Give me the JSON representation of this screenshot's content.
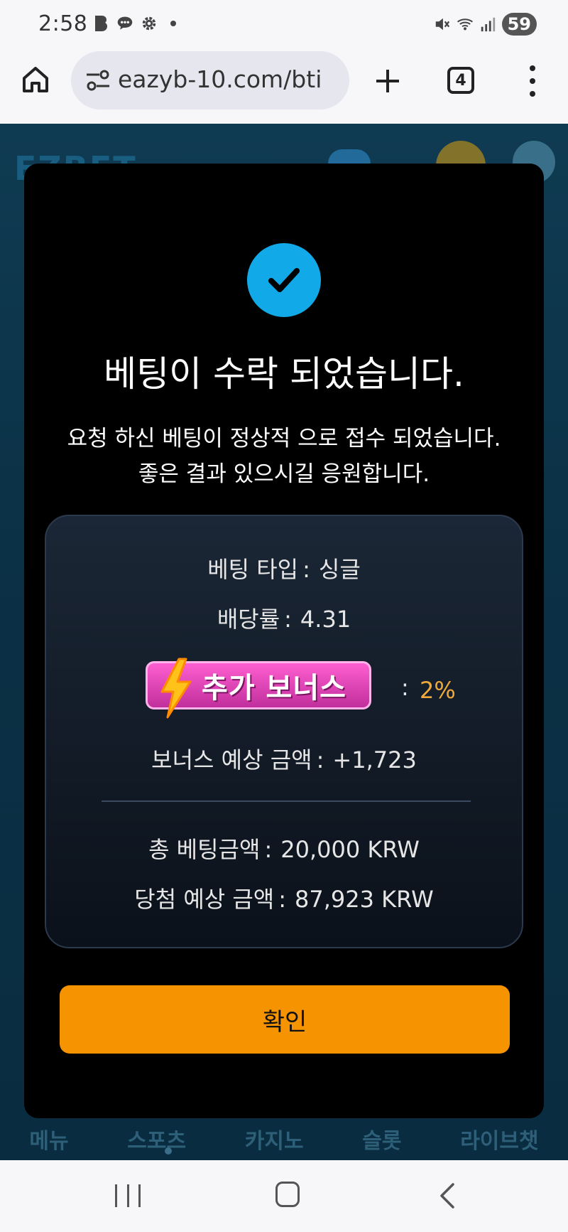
{
  "status_bar": {
    "time": "2:58",
    "battery": "59",
    "icons_left": [
      "b-app-icon",
      "chat-icon",
      "gear-icon",
      "dot-icon"
    ],
    "icons_right": [
      "mute-icon",
      "wifi-icon",
      "signal-icon"
    ]
  },
  "browser": {
    "url": "eazyb-10.com/bti",
    "tab_count": "4"
  },
  "background_site": {
    "logo": "EZBET",
    "bottom_nav": [
      "메뉴",
      "스포츠",
      "카지노",
      "슬롯",
      "라이브챗"
    ]
  },
  "modal": {
    "title": "베팅이 수락 되었습니다.",
    "description": "요청 하신 베팅이 정상적 으로 접수 되었습니다. 좋은 결과 있으시길 응원합니다.",
    "bet_type": {
      "label": "베팅 타입",
      "value": "싱글"
    },
    "odds": {
      "label": "배당률",
      "value": "4.31"
    },
    "bonus": {
      "badge": "추가 보너스",
      "value": "2%"
    },
    "bonus_amount": {
      "label": "보너스 예상 금액",
      "value": "+1,723"
    },
    "total_bet": {
      "label": "총 베팅금액",
      "value": "20,000 KRW"
    },
    "expected_win": {
      "label": "당첨 예상 금액",
      "value": "87,923 KRW"
    },
    "confirm_label": "확인"
  },
  "colors": {
    "accent_orange": "#f59300",
    "check_blue": "#12a9e8",
    "bonus_value": "#f2a93b",
    "badge_pink": "#e04bbd"
  }
}
